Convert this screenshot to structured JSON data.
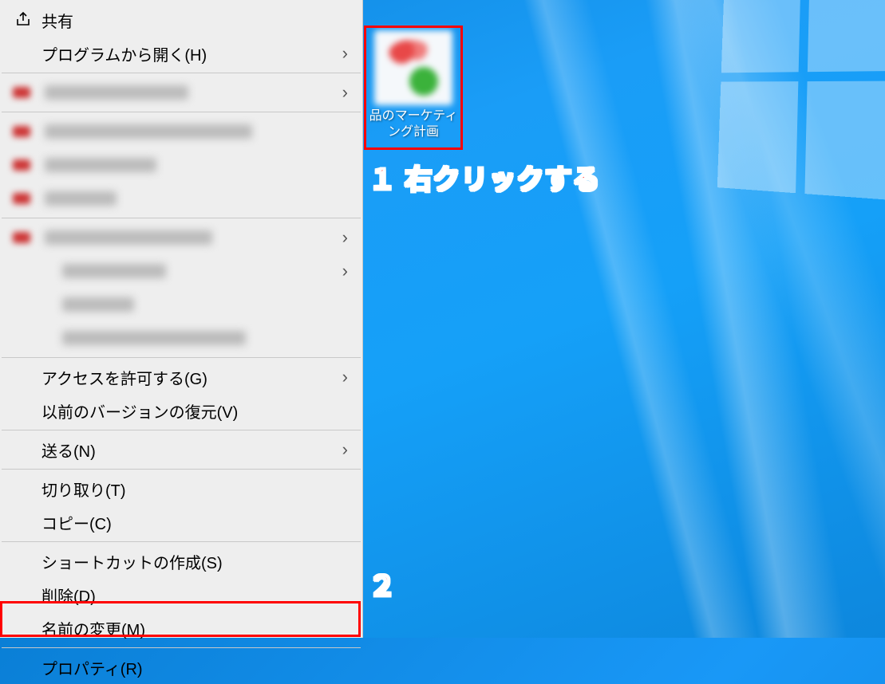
{
  "desktop": {
    "icon_label": "品のマーケティング計画"
  },
  "menu": {
    "share": "共有",
    "open_with": "プログラムから開く(H)",
    "grant_access": "アクセスを許可する(G)",
    "restore_versions": "以前のバージョンの復元(V)",
    "send_to": "送る(N)",
    "cut": "切り取り(T)",
    "copy": "コピー(C)",
    "create_shortcut": "ショートカットの作成(S)",
    "delete": "削除(D)",
    "rename": "名前の変更(M)",
    "properties": "プロパティ(R)"
  },
  "annotations": {
    "step1": "１ 右クリックする",
    "step2": "２"
  }
}
